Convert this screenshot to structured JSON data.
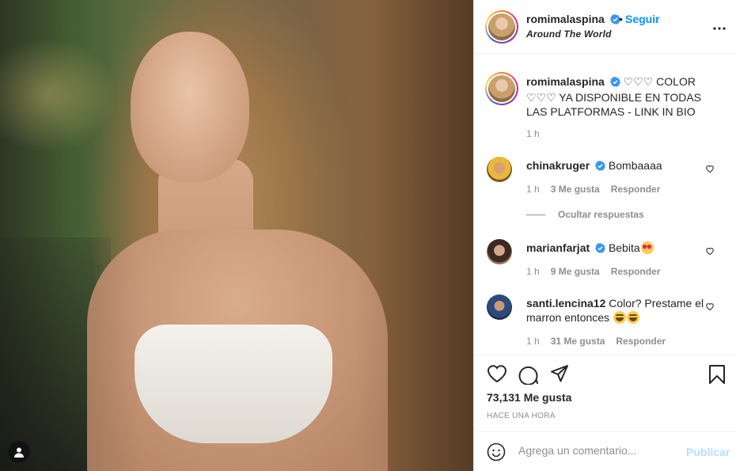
{
  "post": {
    "username": "romimalaspina",
    "follow_label": "Seguir",
    "separator": "•",
    "location": "Around The World",
    "caption_text": "♡♡♡ COLOR ♡♡♡ YA DISPONIBLE EN TODAS LAS PLATFORMAS - LINK IN BIO",
    "caption_time": "1 h"
  },
  "comments": [
    {
      "username": "chinakruger",
      "verified": true,
      "text": "Bombaaaa",
      "emoji": "",
      "time": "1 h",
      "likes": "3 Me gusta",
      "reply": "Responder"
    },
    {
      "username": "marianfarjat",
      "verified": true,
      "text": "Bebita",
      "emoji": "smiling-face-with-heart-eyes",
      "time": "1 h",
      "likes": "9 Me gusta",
      "reply": "Responder"
    },
    {
      "username": "santi.lencina12",
      "verified": false,
      "text": "Color? Prestame el marron entonces",
      "emoji": "face-with-tears-of-joy x2",
      "time": "1 h",
      "likes": "31 Me gusta",
      "reply": "Responder"
    }
  ],
  "hide_replies": "Ocultar respuestas",
  "likes_count": "73,131 Me gusta",
  "posted_time": "HACE UNA HORA",
  "comment_box": {
    "placeholder": "Agrega un comentario...",
    "publish_label": "Publicar"
  },
  "colors": {
    "link_blue": "#0095f6",
    "muted": "#8e8e8e",
    "text": "#262626",
    "publish_disabled": "#b2dffc",
    "verified": "#3897f0"
  },
  "icons": [
    "verified-badge-icon",
    "more-options-icon",
    "heart-icon",
    "comment-icon",
    "share-icon",
    "bookmark-icon",
    "emoji-icon",
    "user-tag-icon"
  ]
}
